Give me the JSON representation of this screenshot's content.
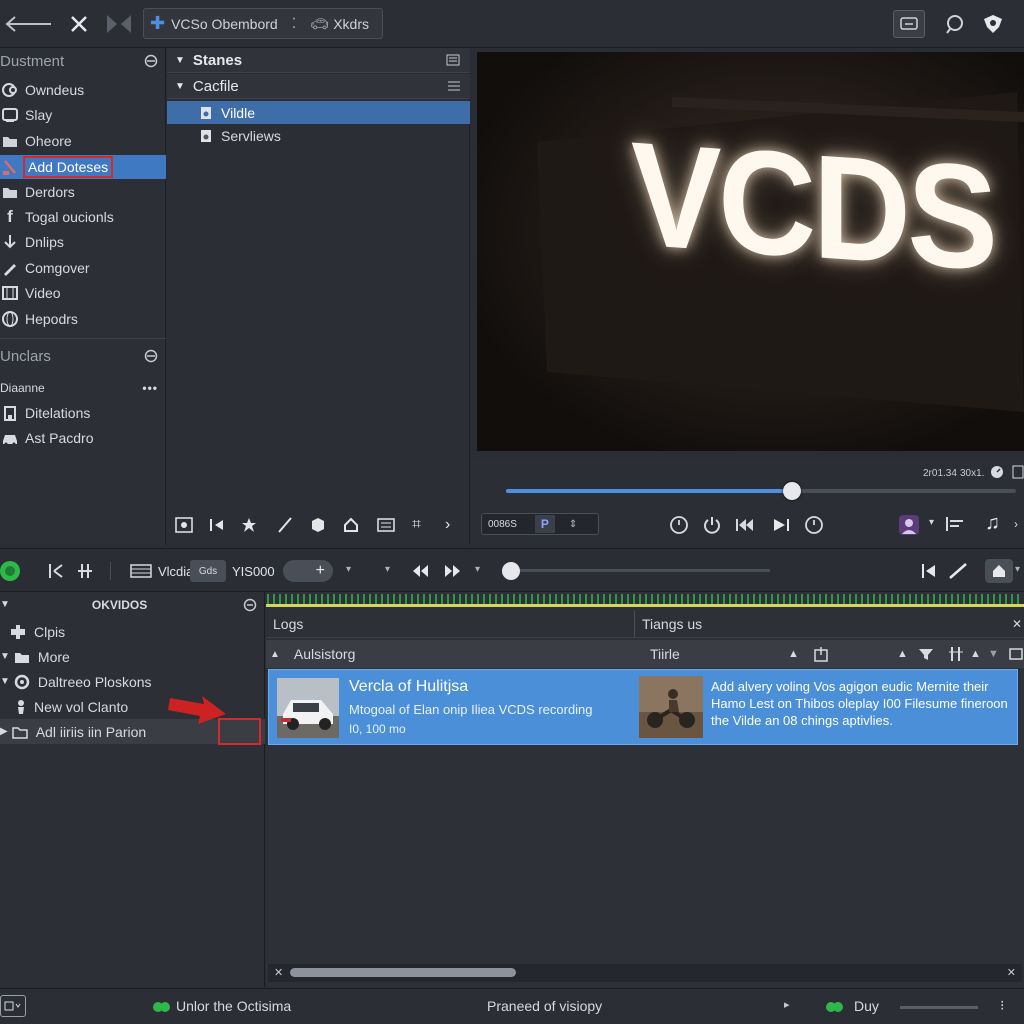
{
  "topbar": {
    "project_label": "VCSo Obembord",
    "right_label": "Xkdrs"
  },
  "sidebar": {
    "section1": "Dustment",
    "items": [
      {
        "label": "Owndeus",
        "icon": "link-icon"
      },
      {
        "label": "Slay",
        "icon": "device-icon"
      },
      {
        "label": "Oheore",
        "icon": "folder-icon"
      },
      {
        "label": "Add Doteses",
        "icon": "brush-icon"
      },
      {
        "label": "Derdors",
        "icon": "folder-icon"
      },
      {
        "label": "Togal oucionls",
        "icon": "facebook-icon"
      },
      {
        "label": "Dnlips",
        "icon": "download-icon"
      },
      {
        "label": "Comgover",
        "icon": "pen-icon"
      },
      {
        "label": "Video",
        "icon": "film-icon"
      },
      {
        "label": "Hepodrs",
        "icon": "globe-icon"
      }
    ],
    "section2": "Unclars",
    "subhead": "Diaanne",
    "items2": [
      {
        "label": "Ditelations",
        "icon": "building-icon"
      },
      {
        "label": "Ast Pacdro",
        "icon": "car-icon"
      }
    ]
  },
  "middle": {
    "head1": "Stanes",
    "head2": "Cacfile",
    "items": [
      {
        "label": "Vildle"
      },
      {
        "label": "Servliews"
      }
    ]
  },
  "preview": {
    "title_text": "VCDS"
  },
  "transport": {
    "time1": "2r01.34",
    "time2": "30x1.",
    "timecode": "0086S",
    "progress": 0.56
  },
  "timeline": {
    "label_media": "Vlcdia",
    "badge": "Gds",
    "label_right": "YIS000"
  },
  "lowleft": {
    "head": "OKVIDOS",
    "items": [
      {
        "label": "Clpis",
        "icon": "puzzle-icon"
      },
      {
        "label": "More",
        "icon": "folder-icon"
      },
      {
        "label": "Daltreeo Ploskons",
        "icon": "gear-icon"
      },
      {
        "label": "New vol Clanto",
        "icon": "person-icon"
      },
      {
        "label": "Adl iiriis iin Parion",
        "icon": "folder-icon"
      }
    ]
  },
  "lowright": {
    "tab1": "Logs",
    "tab2": "Tiangs us",
    "col1": "Aulsistorg",
    "col2": "Tiirle",
    "row": {
      "title": "Vercla of Hulitjsa",
      "desc1": "Mtogoal of Elan onip Iliea VCDS recording",
      "desc2": "I0, 100 mo",
      "right_text": "Add alvery voling Vos agigon eudic Mernite their Hamo Lest on Thibos oleplay I00 Filesume fineroon the Vilde an 08 chings aptivlies."
    }
  },
  "status": {
    "left": "Unlor the Octisima",
    "center": "Praneed of visiopy",
    "right": "Duy"
  },
  "colors": {
    "accent": "#3f79c1",
    "selection_row": "#4a8fd8",
    "annotation": "#d32a2a",
    "green": "#2fb84a"
  }
}
